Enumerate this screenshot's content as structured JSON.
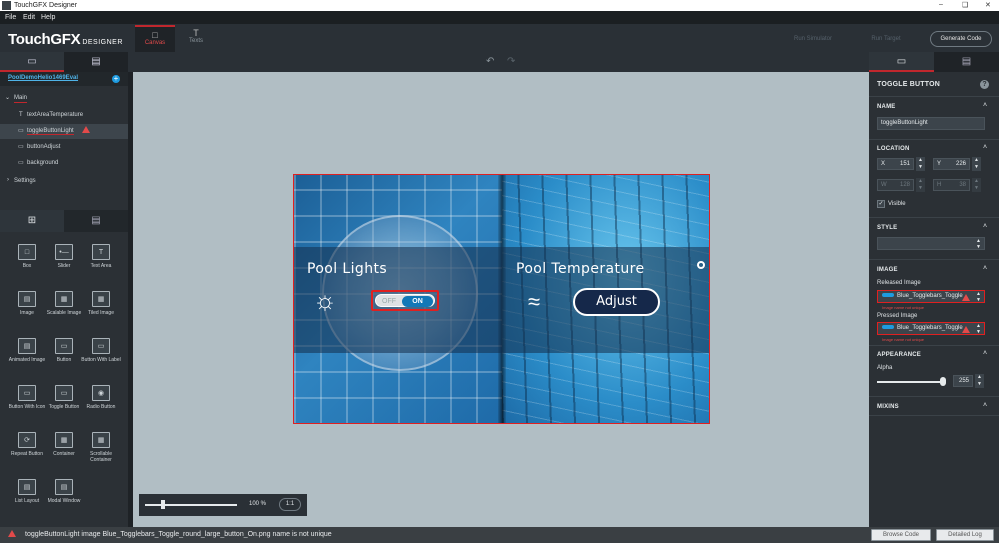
{
  "app": {
    "window_title": "TouchGFX Designer"
  },
  "menu": [
    "File",
    "Edit",
    "Help"
  ],
  "header": {
    "logo_main": "TouchGFX",
    "logo_sub": "DESIGNER",
    "tabs": [
      {
        "label": "Canvas"
      },
      {
        "label": "Texts"
      }
    ],
    "run_simulator": "Run Simulator",
    "run_target": "Run Target",
    "generate_code": "Generate Code"
  },
  "tree": {
    "project": "PoolDemoHelio1469Eval",
    "screen": "Main",
    "items": [
      "textAreaTemperature",
      "toggleButtonLight",
      "buttonAdjust",
      "background"
    ],
    "settings": "Settings"
  },
  "widgets": [
    {
      "label": "Box",
      "icon": "box-icon"
    },
    {
      "label": "Slider",
      "icon": "slider-icon"
    },
    {
      "label": "Text Area",
      "icon": "text-area-icon"
    },
    {
      "label": "Image",
      "icon": "image-icon"
    },
    {
      "label": "Scalable Image",
      "icon": "scalable-image-icon"
    },
    {
      "label": "Tiled Image",
      "icon": "tiled-image-icon"
    },
    {
      "label": "Animated Image",
      "icon": "animated-image-icon"
    },
    {
      "label": "Button",
      "icon": "button-icon"
    },
    {
      "label": "Button With Label",
      "icon": "button-label-icon"
    },
    {
      "label": "Button With Icon",
      "icon": "button-icon-icon"
    },
    {
      "label": "Toggle Button",
      "icon": "toggle-button-icon"
    },
    {
      "label": "Radio Button",
      "icon": "radio-button-icon"
    },
    {
      "label": "Repeat Button",
      "icon": "repeat-button-icon"
    },
    {
      "label": "Container",
      "icon": "container-icon"
    },
    {
      "label": "Scrollable Container",
      "icon": "scrollable-container-icon"
    },
    {
      "label": "List Layout",
      "icon": "list-layout-icon"
    },
    {
      "label": "Modal Window",
      "icon": "modal-window-icon"
    }
  ],
  "screen_preview": {
    "pool_lights": "Pool Lights",
    "toggle_off": "OFF",
    "toggle_on": "ON",
    "pool_temperature": "Pool Temperature",
    "adjust": "Adjust"
  },
  "zoom": {
    "value": "100 %",
    "reset": "1:1",
    "level": 0.2
  },
  "properties": {
    "title": "TOGGLE BUTTON",
    "name_section": "NAME",
    "name_value": "toggleButtonLight",
    "location_section": "LOCATION",
    "x_label": "X",
    "x_value": "151",
    "y_label": "Y",
    "y_value": "226",
    "w_label": "W",
    "w_value": "128",
    "h_label": "H",
    "h_value": "38",
    "visible_label": "Visible",
    "style_section": "STYLE",
    "image_section": "IMAGE",
    "released_label": "Released Image",
    "released_value": "Blue_Togglebars_Toggle",
    "released_error": "Image name not unique",
    "pressed_label": "Pressed Image",
    "pressed_value": "Blue_Togglebars_Toggle",
    "pressed_error": "Image name not unique",
    "appearance_section": "APPEARANCE",
    "alpha_label": "Alpha",
    "alpha_value": "255",
    "alpha_level": 1.0,
    "mixins_section": "MIXINS"
  },
  "status": {
    "message": "toggleButtonLight image Blue_Togglebars_Toggle_round_large_button_On.png name is not unique",
    "browse_code": "Browse Code",
    "detailed_log": "Detailed Log"
  },
  "colors": {
    "accent_red": "#c1272d",
    "toggle_blue": "#1278b7",
    "canvas_bg": "#b1bec4"
  }
}
